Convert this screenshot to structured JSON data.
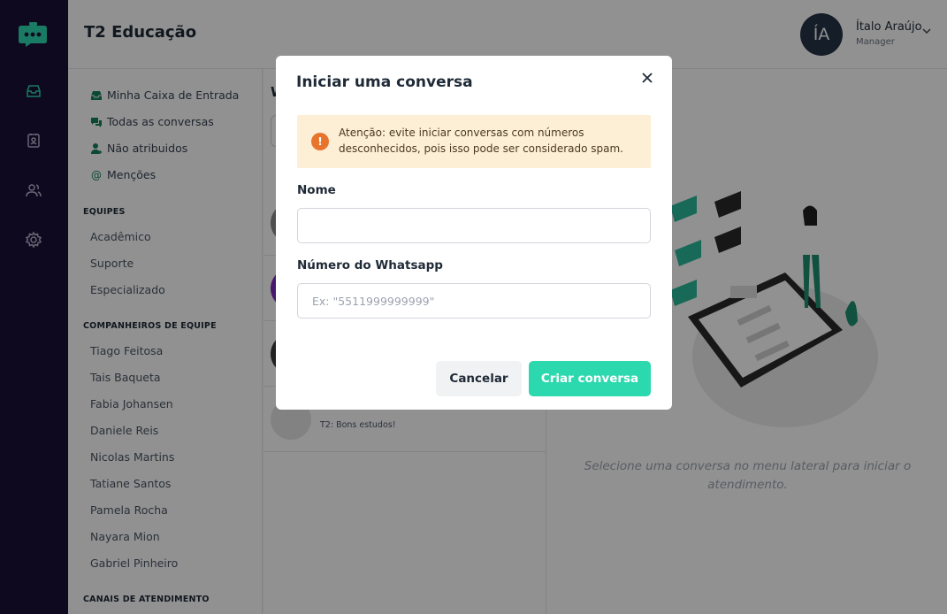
{
  "header": {
    "brand": "T2 Educação",
    "avatar_initials": "ÍA",
    "user_name": "Ítalo Araújo",
    "user_role": "Manager",
    "dropdown_icon": "chevron-down-icon"
  },
  "rail": {
    "icons": [
      "logo-chat-icon",
      "inbox-icon",
      "contacts-book-icon",
      "users-icon",
      "gear-icon"
    ]
  },
  "sidebar": {
    "nav": [
      {
        "label": "Minha Caixa de Entrada",
        "icon": "inbox-icon"
      },
      {
        "label": "Todas as conversas",
        "icon": "chat-bubbles-icon"
      },
      {
        "label": "Não atribuidos",
        "icon": "add-user-icon"
      },
      {
        "label": "Menções",
        "icon": "at-icon"
      }
    ],
    "teams_heading": "EQUIPES",
    "teams": [
      "Acadêmico",
      "Suporte",
      "Especializado"
    ],
    "mates_heading": "COMPANHEIROS DE EQUIPE",
    "mates": [
      "Tiago Feitosa",
      "Tais Baqueta",
      "Fabia Johansen",
      "Daniele Reis",
      "Nicolas Martins",
      "Tatiane Santos",
      "Pamela Rocha",
      "Nayara Mion",
      "Gabriel Pinheiro"
    ],
    "channels_heading": "CANAIS DE ATENDIMENTO"
  },
  "conversations": {
    "title_partial": "W",
    "last_message": "T2: Bons estudos!"
  },
  "main": {
    "hint": "Selecione uma conversa no menu lateral para iniciar o atendimento."
  },
  "modal": {
    "title": "Iniciar uma conversa",
    "warning": "Atenção: evite iniciar conversas com números desconhecidos, pois isso pode ser considerado spam.",
    "name_label": "Nome",
    "name_value": "",
    "phone_label": "Número do Whatsapp",
    "phone_placeholder": "Ex: \"5511999999999\"",
    "cancel_label": "Cancelar",
    "create_label": "Criar conversa"
  },
  "colors": {
    "rail": "#1b1139",
    "accent": "#2cd8ae",
    "warning_bg": "#fdeed6",
    "warning_icon": "#e8742c"
  }
}
